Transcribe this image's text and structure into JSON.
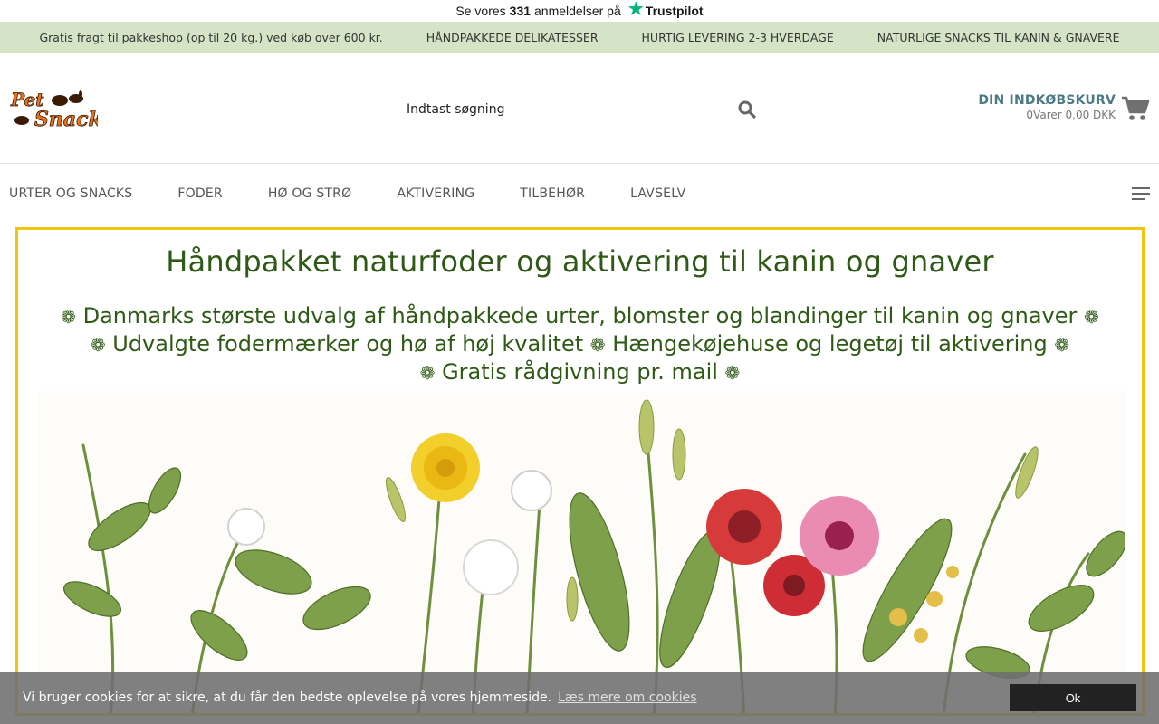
{
  "trustpilot": {
    "prefix": "Se vores",
    "count": "331",
    "suffix": "anmeldelser på",
    "brand": "Trustpilot"
  },
  "usp": [
    "Gratis fragt til pakkeshop (op til 20 kg.) ved køb over 600 kr.",
    "HÅNDPAKKEDE DELIKATESSER",
    "HURTIG LEVERING 2-3 HVERDAGE",
    "NATURLIGE SNACKS TIL KANIN & GNAVERE"
  ],
  "logo": {
    "line1": "Pet",
    "line2": "Snack"
  },
  "search": {
    "placeholder": "Indtast søgning"
  },
  "cart": {
    "title": "DIN INDKØBSKURV",
    "summary": "0Varer 0,00 DKK"
  },
  "nav": [
    "URTER OG SNACKS",
    "FODER",
    "HØ OG STRØ",
    "AKTIVERING",
    "TILBEHØR",
    "LAVSELV"
  ],
  "hero": {
    "title": "Håndpakket naturfoder og aktivering til kanin og gnaver",
    "line1": "Danmarks største udvalg af håndpakkede urter, blomster og blandinger til kanin og gnaver",
    "line2a": "Udvalgte fodermærker og hø af høj kvalitet",
    "line2b": "Hængekøjehuse og legetøj til aktivering",
    "line3": "Gratis rådgivning pr. mail",
    "flower_glyph": "❁"
  },
  "cookie": {
    "text": "Vi bruger cookies for at sikre, at du får den bedste oplevelse på vores hjemmeside.",
    "link": "Læs mere om cookies",
    "button": "Ok"
  },
  "colors": {
    "usp_bg": "#d5e4c7",
    "hero_border": "#f1c40f",
    "hero_text": "#2f5a16",
    "cart_title": "#4a7a84",
    "trustpilot_star": "#00b67a"
  }
}
